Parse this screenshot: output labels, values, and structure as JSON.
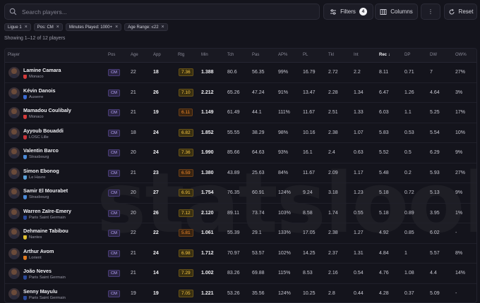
{
  "search": {
    "placeholder": "Search players..."
  },
  "toolbar": {
    "filters_label": "Filters",
    "filters_count": "4",
    "columns_label": "Columns",
    "more_label": "⋮",
    "reset_label": "Reset"
  },
  "chips": [
    "Ligue 1",
    "Pos: CM",
    "Minutes Played: 1000+",
    "Age Range: ≤22"
  ],
  "chip_close": "×",
  "showing": "Showing 1–12 of 12 players",
  "watermark": "statslook",
  "columns": [
    "Player",
    "Pos",
    "Age",
    "App",
    "Rtg",
    "Min",
    "Tch",
    "Pas",
    "AP%",
    "PL",
    "Tkl",
    "Int",
    "Rec",
    "DP",
    "DW",
    "OW%"
  ],
  "sort_column": "Rec",
  "rows": [
    {
      "name": "Lamine Camara",
      "club": "Monaco",
      "crest": "#d33a3a",
      "pos": "CM",
      "age": "22",
      "app": "18",
      "rtg": "7.36",
      "min": "1.388",
      "tch": "80.6",
      "pas": "56.35",
      "ap": "99%",
      "pl": "16.79",
      "tkl": "2.72",
      "int": "2.2",
      "rec": "8.11",
      "dp": "0.71",
      "dw": "7",
      "ow": "27%"
    },
    {
      "name": "Kévin Danois",
      "club": "Auxerre",
      "crest": "#3a6bd3",
      "pos": "CM",
      "age": "21",
      "app": "26",
      "rtg": "7.10",
      "min": "2.212",
      "tch": "65.26",
      "pas": "47.24",
      "ap": "91%",
      "pl": "13.47",
      "tkl": "2.28",
      "int": "1.34",
      "rec": "6.47",
      "dp": "1.26",
      "dw": "4.64",
      "ow": "3%"
    },
    {
      "name": "Mamadou Coulibaly",
      "club": "Monaco",
      "crest": "#d33a3a",
      "pos": "CM",
      "age": "21",
      "app": "19",
      "rtg": "6.11",
      "min": "1.149",
      "tch": "61.49",
      "pas": "44.1",
      "ap": "111%",
      "pl": "11.67",
      "tkl": "2.51",
      "int": "1.33",
      "rec": "6.03",
      "dp": "1.1",
      "dw": "5.25",
      "ow": "17%"
    },
    {
      "name": "Ayyoub Bouaddi",
      "club": "LOSC Lille",
      "crest": "#c8333a",
      "pos": "CM",
      "age": "18",
      "app": "24",
      "rtg": "6.82",
      "min": "1.852",
      "tch": "55.55",
      "pas": "38.29",
      "ap": "98%",
      "pl": "10.16",
      "tkl": "2.38",
      "int": "1.07",
      "rec": "5.83",
      "dp": "0.53",
      "dw": "5.54",
      "ow": "10%"
    },
    {
      "name": "Valentin Barco",
      "club": "Strasbourg",
      "crest": "#4a8ad8",
      "pos": "CM",
      "age": "20",
      "app": "24",
      "rtg": "7.36",
      "min": "1.990",
      "tch": "85.66",
      "pas": "64.63",
      "ap": "93%",
      "pl": "16.1",
      "tkl": "2.4",
      "int": "0.63",
      "rec": "5.52",
      "dp": "0.5",
      "dw": "6.29",
      "ow": "9%"
    },
    {
      "name": "Simon Ebonog",
      "club": "Le Havre",
      "crest": "#5aa0d8",
      "pos": "CM",
      "age": "21",
      "app": "23",
      "rtg": "6.59",
      "min": "1.380",
      "tch": "43.89",
      "pas": "25.63",
      "ap": "84%",
      "pl": "11.67",
      "tkl": "2.09",
      "int": "1.17",
      "rec": "5.48",
      "dp": "0.2",
      "dw": "5.93",
      "ow": "27%"
    },
    {
      "name": "Samir El Mourabet",
      "club": "Strasbourg",
      "crest": "#4a8ad8",
      "pos": "CM",
      "age": "20",
      "app": "27",
      "rtg": "6.91",
      "min": "1.754",
      "tch": "76.35",
      "pas": "60.91",
      "ap": "124%",
      "pl": "9.24",
      "tkl": "3.18",
      "int": "1.23",
      "rec": "5.18",
      "dp": "0.72",
      "dw": "5.13",
      "ow": "9%"
    },
    {
      "name": "Warren Zaïre-Emery",
      "club": "Paris Saint Germain",
      "crest": "#2a4a9a",
      "pos": "CM",
      "age": "20",
      "app": "26",
      "rtg": "7.12",
      "min": "2.120",
      "tch": "89.11",
      "pas": "73.74",
      "ap": "103%",
      "pl": "8.58",
      "tkl": "1.74",
      "int": "0.55",
      "rec": "5.18",
      "dp": "0.89",
      "dw": "3.95",
      "ow": "1%"
    },
    {
      "name": "Dehmaine Tabibou",
      "club": "Nantes",
      "crest": "#e0c030",
      "pos": "CM",
      "age": "22",
      "app": "22",
      "rtg": "5.81",
      "min": "1.061",
      "tch": "55.39",
      "pas": "29.1",
      "ap": "133%",
      "pl": "17.05",
      "tkl": "2.38",
      "int": "1.27",
      "rec": "4.92",
      "dp": "0.85",
      "dw": "6.02",
      "ow": "-"
    },
    {
      "name": "Arthur Avom",
      "club": "Lorient",
      "crest": "#e07a20",
      "pos": "CM",
      "age": "21",
      "app": "24",
      "rtg": "6.98",
      "min": "1.712",
      "tch": "70.97",
      "pas": "53.57",
      "ap": "102%",
      "pl": "14.25",
      "tkl": "2.37",
      "int": "1.31",
      "rec": "4.84",
      "dp": "1",
      "dw": "5.57",
      "ow": "8%"
    },
    {
      "name": "João Neves",
      "club": "Paris Saint Germain",
      "crest": "#2a4a9a",
      "pos": "CM",
      "age": "21",
      "app": "14",
      "rtg": "7.29",
      "min": "1.002",
      "tch": "83.26",
      "pas": "69.88",
      "ap": "115%",
      "pl": "8.53",
      "tkl": "2.16",
      "int": "0.54",
      "rec": "4.76",
      "dp": "1.08",
      "dw": "4.4",
      "ow": "14%"
    },
    {
      "name": "Senny Mayulu",
      "club": "Paris Saint Germain",
      "crest": "#2a4a9a",
      "pos": "CM",
      "age": "19",
      "app": "19",
      "rtg": "7.05",
      "min": "1.221",
      "tch": "53.26",
      "pas": "35.56",
      "ap": "124%",
      "pl": "10.25",
      "tkl": "2.8",
      "int": "0.44",
      "rec": "4.28",
      "dp": "0.37",
      "dw": "5.09",
      "ow": "-"
    }
  ]
}
